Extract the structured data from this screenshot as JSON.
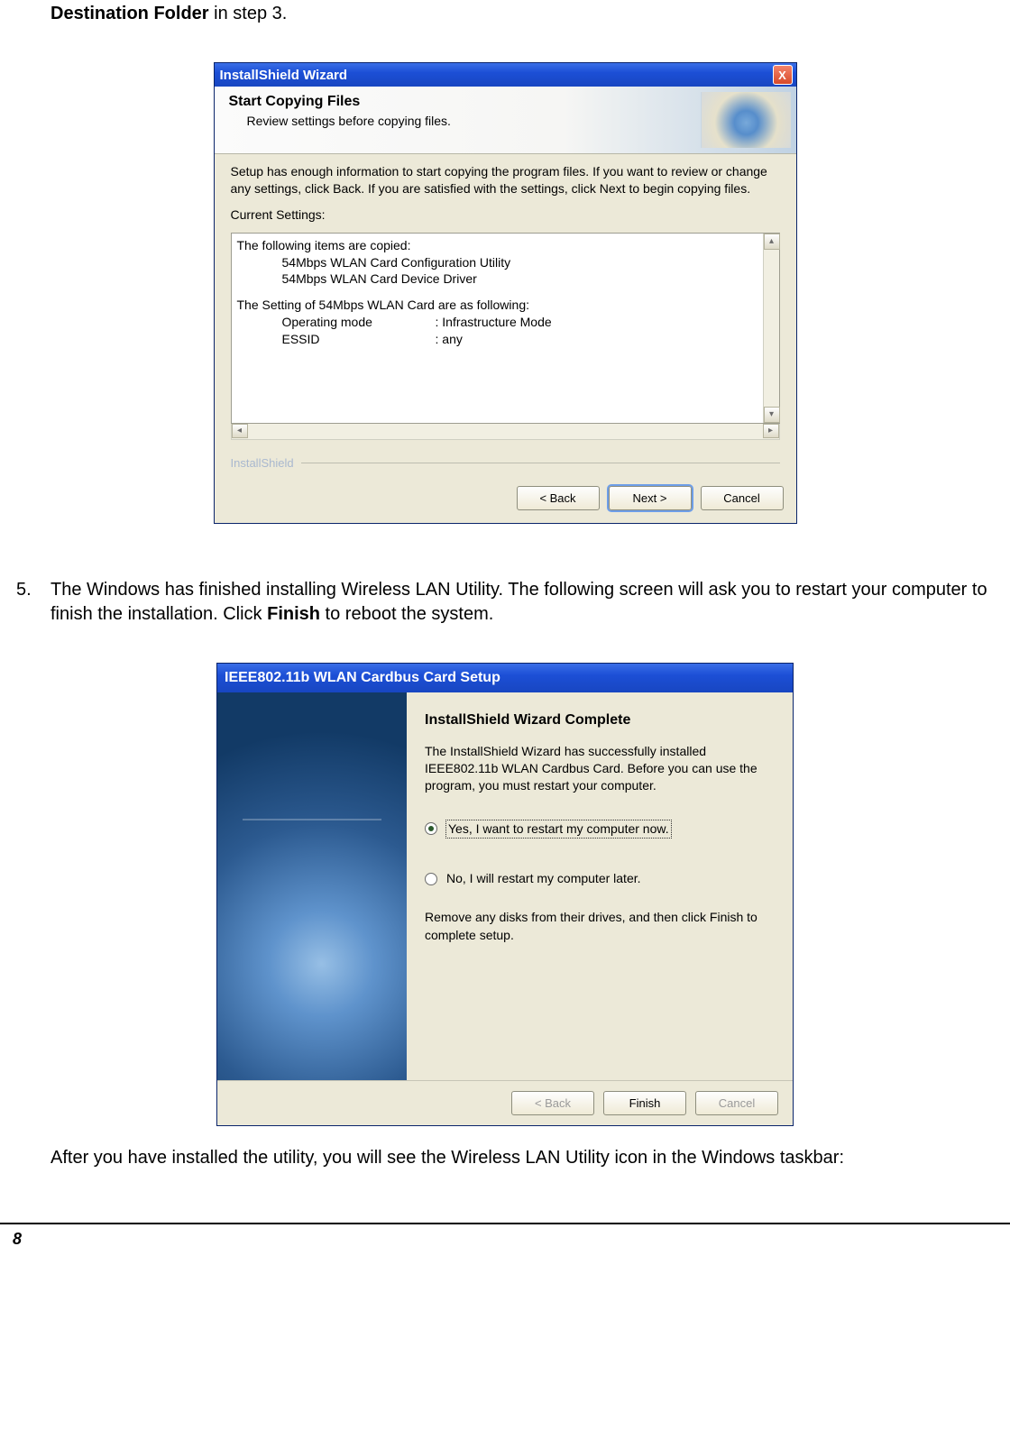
{
  "doc": {
    "top_line_bold": "Destination Folder",
    "top_line_rest": " in step 3.",
    "after_text": "After you have installed the utility, you will see the Wireless LAN Utility icon in the Windows taskbar:",
    "page_number": "8"
  },
  "step5": {
    "num": "5.",
    "text_a": "The Windows has finished installing Wireless LAN Utility. The following screen will ask you to restart your computer to finish the installation. Click ",
    "text_bold": "Finish",
    "text_b": " to reboot the system."
  },
  "dlg1": {
    "title": "InstallShield Wizard",
    "close": "X",
    "heading": "Start Copying Files",
    "subheading": "Review settings before copying files.",
    "intro": "Setup has enough information to start copying the program files.  If you want to review or change any settings, click Back.  If you are satisfied with the settings, click Next to begin copying files.",
    "current_label": "Current Settings:",
    "copied_header": "The following items are copied:",
    "copied_items": [
      "54Mbps WLAN Card Configuration Utility",
      "54Mbps WLAN Card Device Driver"
    ],
    "settings_header": "The Setting of 54Mbps WLAN Card are as following:",
    "settings_rows": [
      {
        "k": "Operating mode",
        "v": ": Infrastructure Mode"
      },
      {
        "k": "ESSID",
        "v": ": any"
      }
    ],
    "footer_label": "InstallShield",
    "buttons": {
      "back": "<  Back",
      "next": "Next >",
      "cancel": "Cancel"
    }
  },
  "dlg2": {
    "title": "IEEE802.11b WLAN Cardbus Card Setup",
    "heading": "InstallShield Wizard Complete",
    "body": "The InstallShield Wizard has successfully installed IEEE802.11b WLAN Cardbus Card.  Before you can use the program, you must restart your computer.",
    "radio_yes": "Yes, I want to restart my computer now.",
    "radio_no": "No, I will restart my computer later.",
    "remove_text": "Remove any disks from their drives, and then click Finish to complete setup.",
    "buttons": {
      "back": "<  Back",
      "finish": "Finish",
      "cancel": "Cancel"
    }
  }
}
